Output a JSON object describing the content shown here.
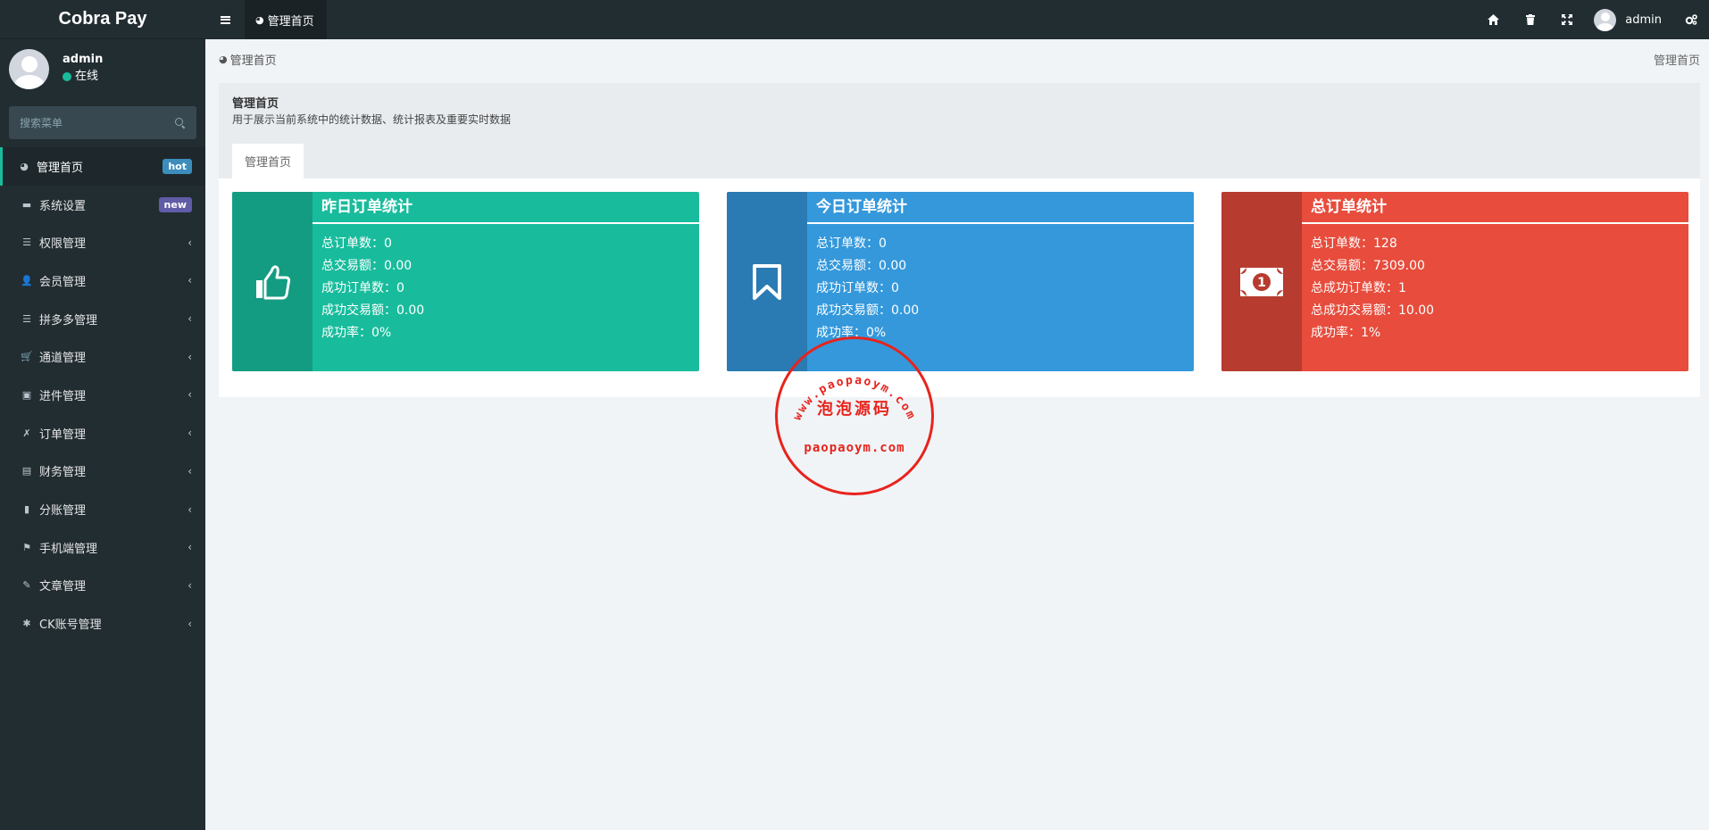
{
  "app": {
    "title": "Cobra Pay"
  },
  "user": {
    "name": "admin",
    "status": "在线"
  },
  "search": {
    "placeholder": "搜索菜单"
  },
  "menu": [
    {
      "label": "管理首页",
      "icon": "dashboard-icon",
      "glyph": "◕",
      "badge": "hot",
      "active": true
    },
    {
      "label": "系统设置",
      "icon": "folder-icon",
      "glyph": "▬",
      "badge": "new"
    },
    {
      "label": "权限管理",
      "icon": "list-icon",
      "glyph": "☰",
      "arrow": "‹"
    },
    {
      "label": "会员管理",
      "icon": "user-add-icon",
      "glyph": "👤",
      "arrow": "‹"
    },
    {
      "label": "拼多多管理",
      "icon": "list-icon",
      "glyph": "☰",
      "arrow": "‹"
    },
    {
      "label": "通道管理",
      "icon": "cart-icon",
      "glyph": "🛒",
      "arrow": "‹"
    },
    {
      "label": "进件管理",
      "icon": "money-icon",
      "glyph": "▣",
      "arrow": "‹"
    },
    {
      "label": "订单管理",
      "icon": "order-icon",
      "glyph": "✗",
      "arrow": "‹"
    },
    {
      "label": "财务管理",
      "icon": "finance-icon",
      "glyph": "▤",
      "arrow": "‹"
    },
    {
      "label": "分账管理",
      "icon": "book-icon",
      "glyph": "▮",
      "arrow": "‹"
    },
    {
      "label": "手机端管理",
      "icon": "flag-icon",
      "glyph": "⚑",
      "arrow": "‹"
    },
    {
      "label": "文章管理",
      "icon": "brush-icon",
      "glyph": "✎",
      "arrow": "‹"
    },
    {
      "label": "CK账号管理",
      "icon": "bug-icon",
      "glyph": "✱",
      "arrow": "‹"
    }
  ],
  "header": {
    "tab_label": "管理首页",
    "username": "admin"
  },
  "breadcrumb": {
    "left": "管理首页",
    "right": "管理首页"
  },
  "panel": {
    "title": "管理首页",
    "description": "用于展示当前系统中的统计数据、统计报表及重要实时数据",
    "tab": "管理首页"
  },
  "cards": {
    "yesterday": {
      "title": "昨日订单统计",
      "lines": [
        "总订单数：0",
        "总交易额：0.00",
        "成功订单数：0",
        "成功交易额：0.00",
        "成功率：0%"
      ]
    },
    "today": {
      "title": "今日订单统计",
      "lines": [
        "总订单数：0",
        "总交易额：0.00",
        "成功订单数：0",
        "成功交易额：0.00",
        "成功率：0%"
      ]
    },
    "total": {
      "title": "总订单统计",
      "lines": [
        "总订单数：128",
        "总交易额：7309.00",
        "总成功订单数：1",
        "总成功交易额：10.00",
        "成功率：1%"
      ]
    }
  },
  "stamp": {
    "arc": "www.paopaoym.com",
    "center": "泡泡源码",
    "bottom": "paopaoym.com"
  },
  "colors": {
    "green": "#18bc9c",
    "blue": "#3498db",
    "red": "#e74c3c",
    "sidebar": "#222d32"
  }
}
